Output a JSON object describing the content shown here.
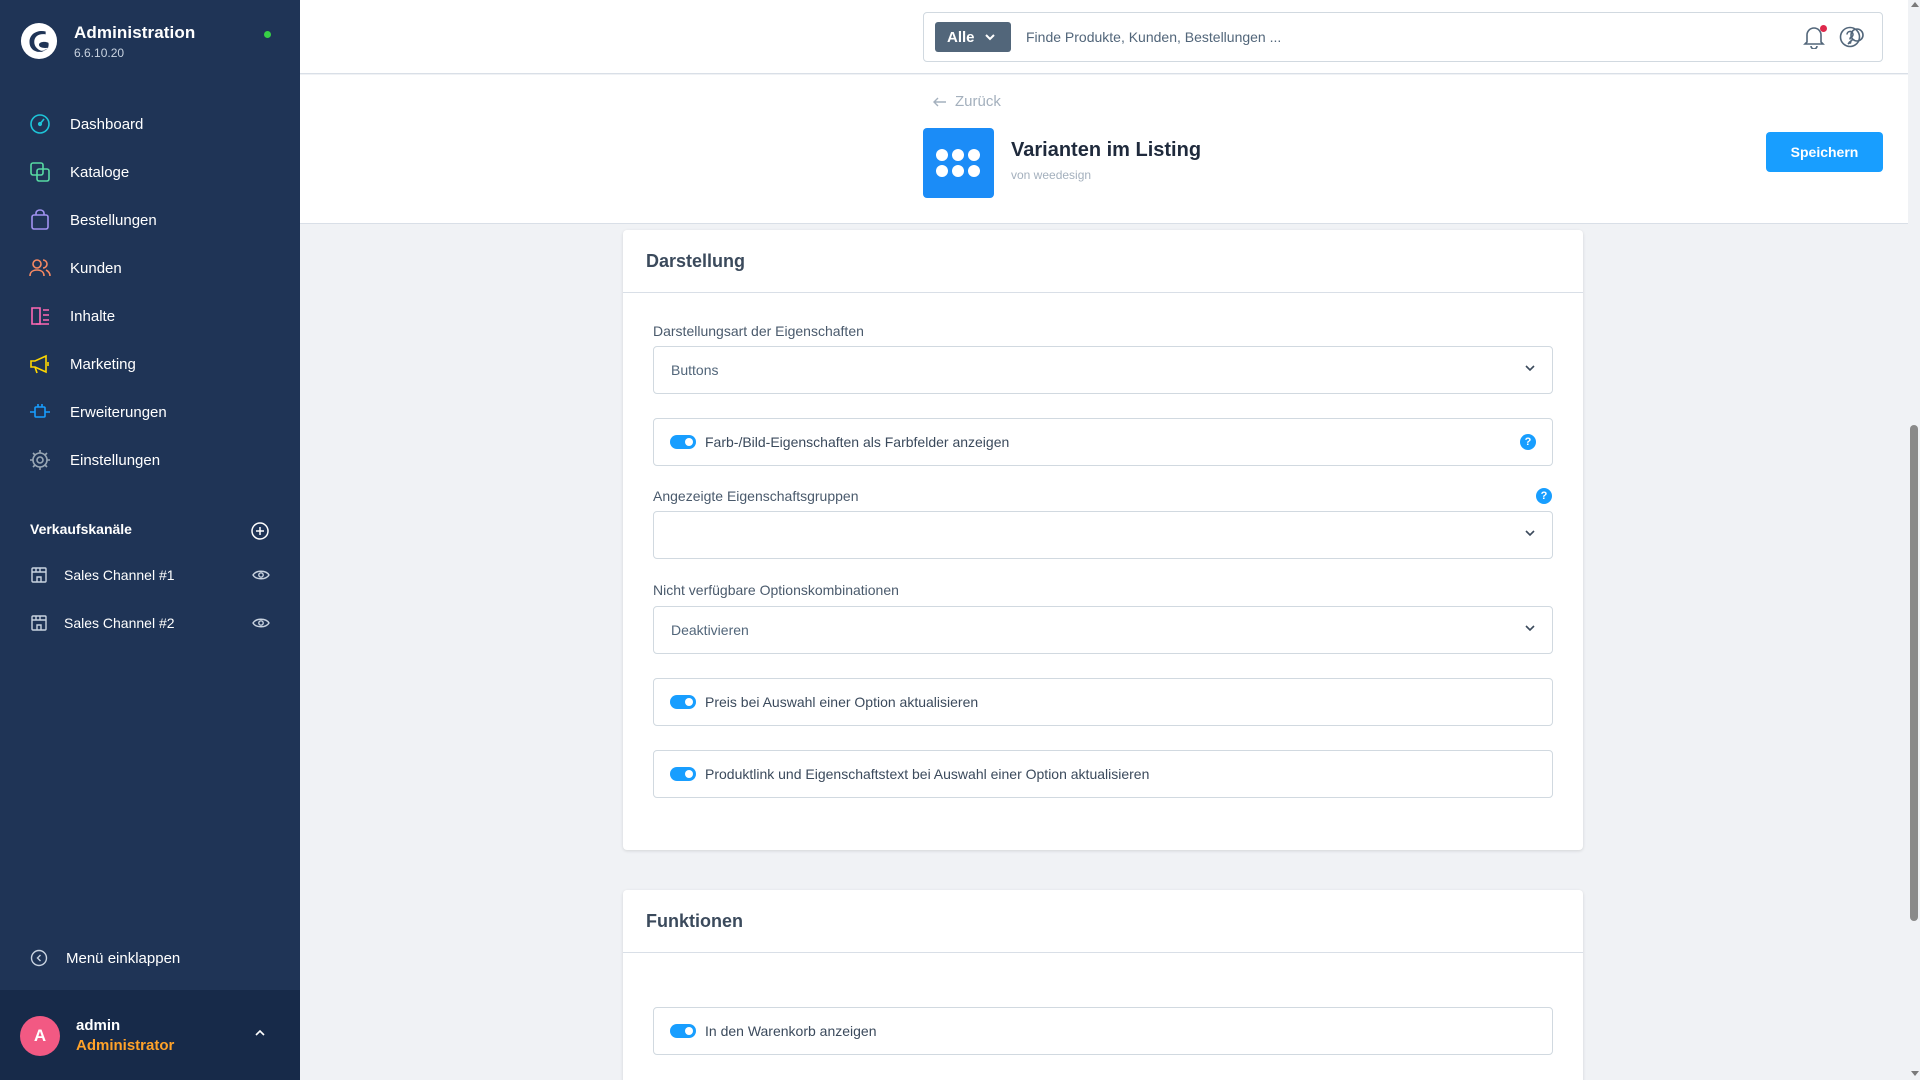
{
  "app": {
    "title": "Administration",
    "version": "6.6.10.20",
    "status_color": "#37d046"
  },
  "nav": {
    "items": [
      {
        "label": "Dashboard",
        "icon": "dashboard-icon",
        "color": "#1ec4d8"
      },
      {
        "label": "Kataloge",
        "icon": "catalog-icon",
        "color": "#57d9a3"
      },
      {
        "label": "Bestellungen",
        "icon": "orders-bag-icon",
        "color": "#a092f0"
      },
      {
        "label": "Kunden",
        "icon": "customers-icon",
        "color": "#f88962"
      },
      {
        "label": "Inhalte",
        "icon": "content-icon",
        "color": "#ff68b4"
      },
      {
        "label": "Marketing",
        "icon": "megaphone-icon",
        "color": "#ffd700"
      },
      {
        "label": "Erweiterungen",
        "icon": "plugin-icon",
        "color": "#189eff"
      },
      {
        "label": "Einstellungen",
        "icon": "gear-icon",
        "color": "#9aa8b5"
      }
    ]
  },
  "sales_channels": {
    "title": "Verkaufskanäle",
    "items": [
      {
        "label": "Sales Channel #1",
        "icon": "storefront-icon"
      },
      {
        "label": "Sales Channel #2",
        "icon": "storefront-icon"
      }
    ]
  },
  "sidebar_footer": {
    "collapse_label": "Menü einklappen",
    "user_initial": "A",
    "user_name": "admin",
    "user_role": "Administrator"
  },
  "search": {
    "type_label": "Alle",
    "placeholder": "Finde Produkte, Kunden, Bestellungen ..."
  },
  "header": {
    "back_label": "Zurück",
    "plugin_title": "Varianten im Listing",
    "plugin_vendor": "von weedesign",
    "save_label": "Speichern"
  },
  "darstellung": {
    "title": "Darstellung",
    "display_type_label": "Darstellungsart der Eigenschaften",
    "display_type_value": "Buttons",
    "color_fields_label": "Farb-/Bild-Eigenschaften als Farbfelder anzeigen",
    "color_fields_on": true,
    "groups_label": "Angezeigte Eigenschaftsgruppen",
    "groups_value": "",
    "unavailable_label": "Nicht verfügbare Optionskombinationen",
    "unavailable_value": "Deaktivieren",
    "update_price_label": "Preis bei Auswahl einer Option aktualisieren",
    "update_price_on": true,
    "update_link_label": "Produktlink und Eigenschaftstext bei Auswahl einer Option aktualisieren",
    "update_link_on": true
  },
  "funktionen": {
    "title": "Funktionen",
    "cart_label": "In den Warenkorb anzeigen",
    "cart_on": true
  },
  "help_glyph": "?"
}
